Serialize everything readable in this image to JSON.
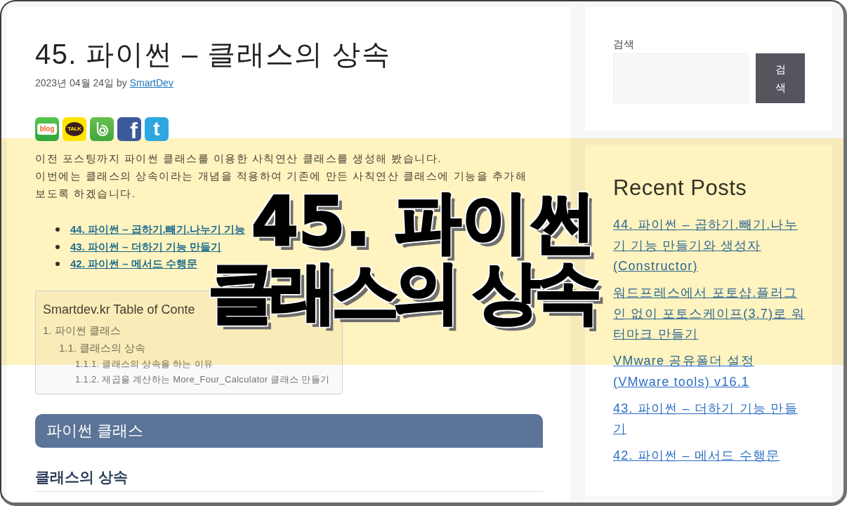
{
  "post": {
    "title": "45. 파이썬 – 클래스의 상속",
    "date": "2023년 04월 24일",
    "byline": "by",
    "author": "SmartDev"
  },
  "share_buttons": [
    {
      "kind": "blog",
      "label": "blog"
    },
    {
      "kind": "kakaotalk",
      "label": "TALK"
    },
    {
      "kind": "band"
    },
    {
      "kind": "facebook",
      "label": "f"
    },
    {
      "kind": "twitter",
      "label": "t"
    }
  ],
  "intro": [
    "이전 포스팅까지 파이썬 클래스를 이용한 사칙연산 클래스를 생성해 봤습니다.",
    "이번에는 클래스의 상속이라는 개념을 적용하여 기존에 만든 사칙연산 클래스에 기능을 추가해 보도록 하겠습니다."
  ],
  "related_posts": [
    "44. 파이썬 – 곱하기.빼기.나누기 기능",
    "43. 파이썬 – 더하기 기능 만들기",
    "42. 파이썬 – 메서드 수행문"
  ],
  "toc": {
    "title": "Smartdev.kr Table of Conte",
    "items": [
      {
        "text": "1. 파이썬 클래스",
        "children": [
          {
            "text": "1.1. 클래스의 상속",
            "children": [
              {
                "text": "1.1.1. 클래스의 상속을 하는 이유"
              },
              {
                "text": "1.1.2. 제곱을 계산하는 More_Four_Calculator 클래스 만들기"
              }
            ]
          }
        ]
      }
    ]
  },
  "section": {
    "heading": "파이썬 클래스",
    "subheading": "클래스의 상속"
  },
  "sidebar": {
    "search": {
      "label": "검색",
      "button": "검색"
    },
    "recent_posts": {
      "title": "Recent Posts",
      "items": [
        "44. 파이썬 – 곱하기.빼기.나누기 기능 만들기와 생성자(Constructor)",
        "워드프레스에서 포토샵.플러그인 없이 포토스케이프(3.7)로 워터마크 만들기",
        "VMware 공유폴더 설정 (VMware tools) v16.1",
        "43. 파이썬 – 더하기 기능 만들기",
        "42. 파이썬 – 메서드 수행문"
      ]
    }
  },
  "overlay": {
    "lines": [
      "45. 파이썬",
      "클래스의 상속"
    ]
  }
}
